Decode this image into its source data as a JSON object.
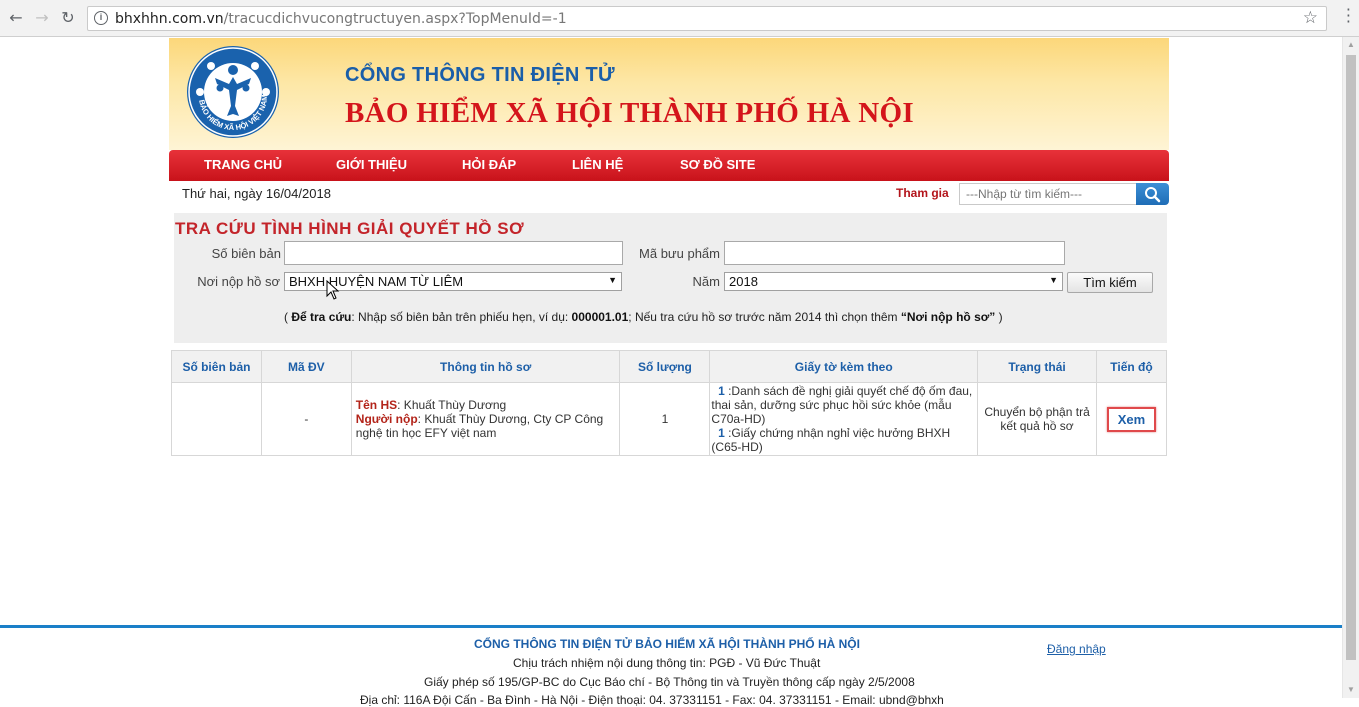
{
  "browser": {
    "url_host": "bhxhhn.com.vn",
    "url_path": "/tracucdichvucongtructuyen.aspx?TopMenuId=-1"
  },
  "header": {
    "logo_text": "BẢO HIỂM XÃ HỘI VIỆT NAM",
    "title_line1": "CỔNG THÔNG TIN ĐIỆN TỬ",
    "title_line2": "BẢO HIỂM XÃ HỘI THÀNH PHỐ HÀ NỘI"
  },
  "nav": {
    "items": [
      "TRANG CHỦ",
      "GIỚI THIỆU",
      "HỎI ĐÁP",
      "LIÊN HỆ",
      "SƠ ĐỒ SITE"
    ]
  },
  "topbar": {
    "date": "Thứ hai, ngày 16/04/2018",
    "join_label": "Tham gia",
    "search_placeholder": "---Nhập từ tìm kiếm---"
  },
  "lookup": {
    "title": "TRA CỨU TÌNH HÌNH GIẢI QUYẾT HỒ SƠ",
    "so_bien_ban_label": "Số biên bản",
    "so_bien_ban_value": "",
    "ma_buu_pham_label": "Mã bưu phẩm",
    "ma_buu_pham_value": "",
    "noi_nop_label": "Nơi nộp hồ sơ",
    "noi_nop_value": "BHXH HUYỆN NAM TỪ LIÊM",
    "nam_label": "Năm",
    "nam_value": "2018",
    "search_button": "Tìm kiếm",
    "hint_open": "( ",
    "hint_b1": "Để tra cứu",
    "hint_t1": ": Nhập số biên bản trên phiếu hẹn, ví dụ: ",
    "hint_b2": "000001.01",
    "hint_t2": "; Nếu tra cứu hồ sơ trước năm 2014 thì chọn thêm ",
    "hint_b3": "“Nơi nộp hồ sơ”",
    "hint_close": " )"
  },
  "table": {
    "headers": [
      "Số biên bản",
      "Mã ĐV",
      "Thông tin hồ sơ",
      "Số lượng",
      "Giấy tờ kèm theo",
      "Trạng thái",
      "Tiến độ"
    ],
    "row": {
      "so_bien_ban": "",
      "ma_dv": "-",
      "ten_hs_label": "Tên HS",
      "ten_hs_value": ": Khuất Thùy Dương",
      "nguoi_nop_label": "Người nộp",
      "nguoi_nop_value": ": Khuất Thùy Dương, Cty CP Công nghệ tin học EFY việt nam",
      "so_luong": "1",
      "att1_num": "1",
      "att1_text": " :Danh sách đề nghị giải quyết chế độ ốm đau, thai sản, dưỡng sức phục hồi sức khỏe (mẫu C70a-HD)",
      "att2_num": "1",
      "att2_text": " :Giấy chứng nhận nghỉ việc hưởng BHXH (C65-HD)",
      "trang_thai": "Chuyển bộ phận trả kết quả hồ sơ",
      "tien_do": "Xem"
    }
  },
  "footer": {
    "title": "CỔNG THÔNG TIN ĐIỆN TỬ BẢO HIỂM XÃ HỘI THÀNH PHỐ HÀ NỘI",
    "login": "Đăng nhập",
    "line2": "Chịu trách nhiệm nội dung thông tin: PGĐ - Vũ Đức Thuật",
    "line3": "Giấy phép số 195/GP-BC do Cục Báo chí - Bộ Thông tin và Truyền thông cấp ngày 2/5/2008",
    "line4": "Địa chỉ: 116A Đội Cấn - Ba Đình - Hà Nội - Điện thoại: 04. 37331151 - Fax: 04. 37331151 - Email: ubnd@bhxh"
  },
  "colors": {
    "brand_blue": "#1d5fa8",
    "brand_red": "#d4151b",
    "nav_red": "#c8121a",
    "banner_yellow": "#fcd77a"
  }
}
